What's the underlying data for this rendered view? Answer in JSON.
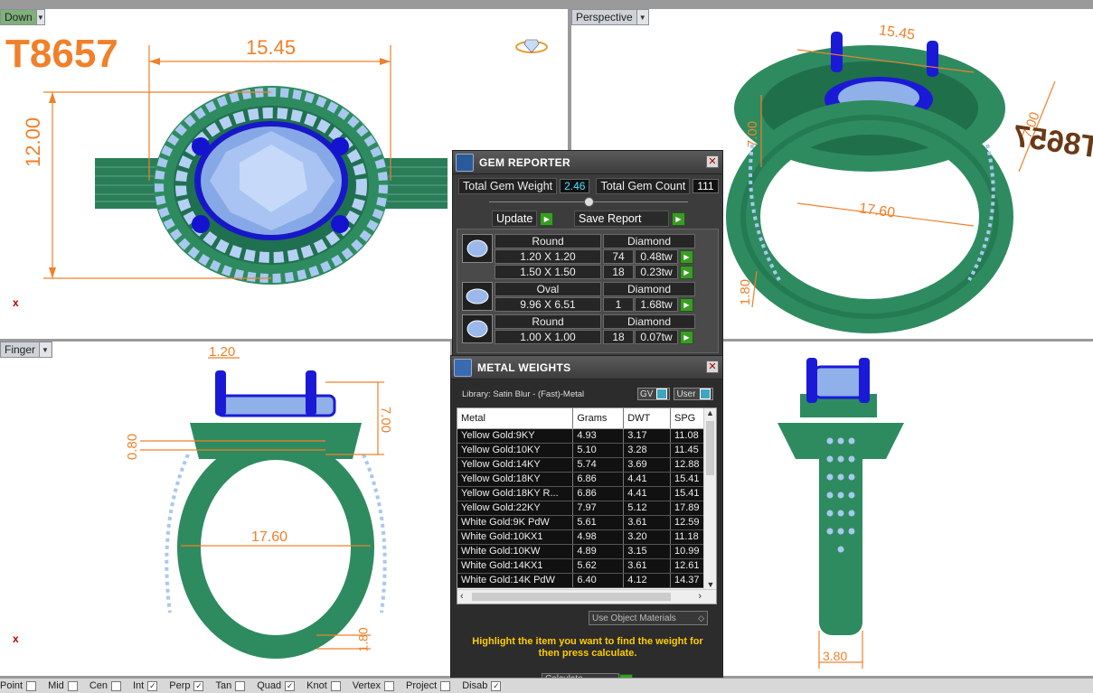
{
  "viewports": {
    "top_left": {
      "tab": "Down",
      "model_id": "T8657",
      "dim_width": "15.45",
      "dim_height": "12.00",
      "axis": "x"
    },
    "top_right": {
      "tab": "Perspective",
      "dim_top": "15.45",
      "dim_left": "7.00",
      "dim_right": "7.00",
      "dim_inner": "17.60",
      "dim_band": "1.80",
      "mirrored_id": "T8657"
    },
    "bottom_left": {
      "tab": "Finger",
      "dim_top": "1.20",
      "dim_right": "7.00",
      "dim_left": "0.80",
      "dim_inner": "17.60",
      "dim_band": "1.80",
      "axis": "x"
    },
    "bottom_right": {
      "dim_band": "3.80"
    }
  },
  "gem_reporter": {
    "title": "GEM REPORTER",
    "total_weight_label": "Total Gem Weight",
    "total_weight_value": "2.46",
    "total_count_label": "Total Gem Count",
    "total_count_value": "111",
    "update_label": "Update",
    "save_label": "Save Report",
    "groups": [
      {
        "shape": "Round",
        "material": "Diamond",
        "rows": [
          {
            "size": "1.20 X 1.20",
            "count": "74",
            "weight": "0.48tw"
          },
          {
            "size": "1.50 X 1.50",
            "count": "18",
            "weight": "0.23tw"
          }
        ]
      },
      {
        "shape": "Oval",
        "material": "Diamond",
        "rows": [
          {
            "size": "9.96 X 6.51",
            "count": "1",
            "weight": "1.68tw"
          }
        ]
      },
      {
        "shape": "Round",
        "material": "Diamond",
        "rows": [
          {
            "size": "1.00 X 1.00",
            "count": "18",
            "weight": "0.07tw"
          }
        ]
      }
    ]
  },
  "metal_weights": {
    "title": "METAL WEIGHTS",
    "library": "Library: Satin Blur - (Fast)-Metal",
    "gv_label": "GV",
    "user_label": "User",
    "columns": [
      "Metal",
      "Grams",
      "DWT",
      "SPG"
    ],
    "rows": [
      [
        "Yellow Gold:9KY",
        "4.93",
        "3.17",
        "11.08"
      ],
      [
        "Yellow Gold:10KY",
        "5.10",
        "3.28",
        "11.45"
      ],
      [
        "Yellow Gold:14KY",
        "5.74",
        "3.69",
        "12.88"
      ],
      [
        "Yellow Gold:18KY",
        "6.86",
        "4.41",
        "15.41"
      ],
      [
        "Yellow Gold:18KY R...",
        "6.86",
        "4.41",
        "15.41"
      ],
      [
        "Yellow Gold:22KY",
        "7.97",
        "5.12",
        "17.89"
      ],
      [
        "White Gold:9K PdW",
        "5.61",
        "3.61",
        "12.59"
      ],
      [
        "White Gold:10KX1",
        "4.98",
        "3.20",
        "11.18"
      ],
      [
        "White Gold:10KW",
        "4.89",
        "3.15",
        "10.99"
      ],
      [
        "White Gold:14KX1",
        "5.62",
        "3.61",
        "12.61"
      ],
      [
        "White Gold:14K PdW",
        "6.40",
        "4.12",
        "14.37"
      ]
    ],
    "use_object_materials": "Use Object Materials",
    "instruction": "Highlight the item you want to find the weight for then press calculate.",
    "calculate_label": "Calculate"
  },
  "status_bar": {
    "items": [
      {
        "label": "Point",
        "checked": false
      },
      {
        "label": "Mid",
        "checked": false
      },
      {
        "label": "Cen",
        "checked": false
      },
      {
        "label": "Int",
        "checked": true
      },
      {
        "label": "Perp",
        "checked": true
      },
      {
        "label": "Tan",
        "checked": false
      },
      {
        "label": "Quad",
        "checked": true
      },
      {
        "label": "Knot",
        "checked": false
      },
      {
        "label": "Vertex",
        "checked": false
      },
      {
        "label": "Project",
        "checked": false
      },
      {
        "label": "Disab",
        "checked": true
      }
    ]
  },
  "colors": {
    "metal": "#2e8b5f",
    "gem": "#8fb0e8",
    "prong": "#1a1ad6",
    "dimension": "#f0802a"
  }
}
